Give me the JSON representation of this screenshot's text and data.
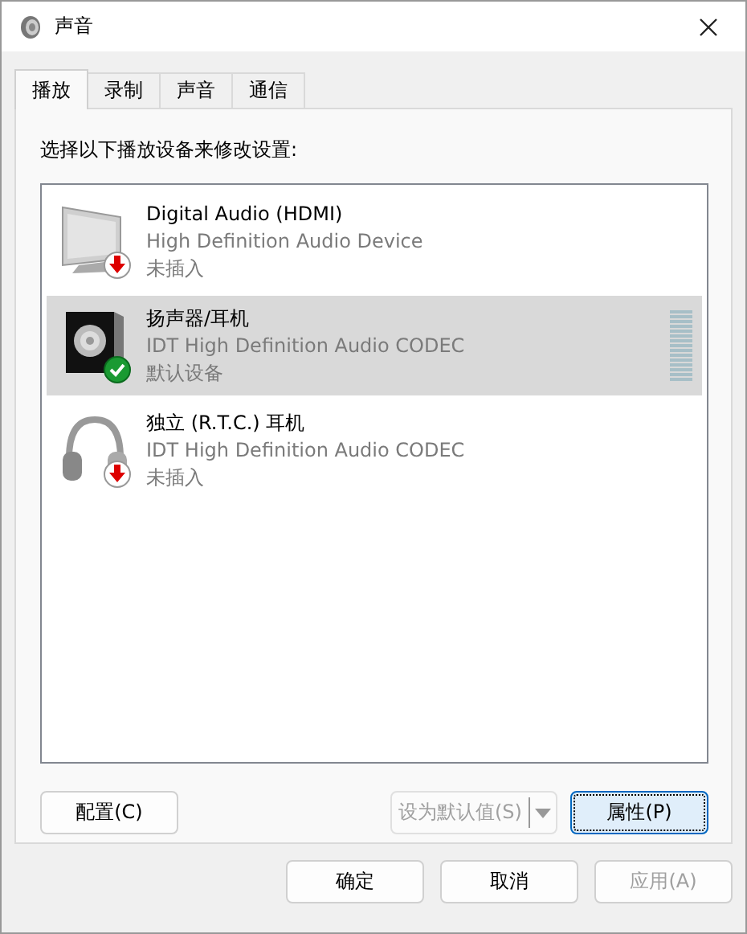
{
  "window": {
    "title": "声音"
  },
  "tabs": [
    {
      "label": "播放",
      "selected": true
    },
    {
      "label": "录制",
      "selected": false
    },
    {
      "label": "声音",
      "selected": false
    },
    {
      "label": "通信",
      "selected": false
    }
  ],
  "instruction": "选择以下播放设备来修改设置:",
  "devices": [
    {
      "name": "Digital Audio (HDMI)",
      "driver": "High Definition Audio Device",
      "status": "未插入",
      "kind": "monitor",
      "unplugged": true,
      "is_default": false,
      "selected": false
    },
    {
      "name": "扬声器/耳机",
      "driver": "IDT High Definition Audio CODEC",
      "status": "默认设备",
      "kind": "speaker",
      "unplugged": false,
      "is_default": true,
      "selected": true
    },
    {
      "name": "独立 (R.T.C.) 耳机",
      "driver": "IDT High Definition Audio CODEC",
      "status": "未插入",
      "kind": "headphones",
      "unplugged": true,
      "is_default": false,
      "selected": false
    }
  ],
  "panel_buttons": {
    "configure": {
      "label": "配置(C)"
    },
    "set_default": {
      "label": "设为默认值(S)",
      "disabled": true
    },
    "properties": {
      "label": "属性(P)",
      "focused": true
    }
  },
  "dialog_buttons": [
    {
      "label": "确定",
      "disabled": false
    },
    {
      "label": "取消",
      "disabled": false
    },
    {
      "label": "应用(A)",
      "disabled": true
    }
  ]
}
